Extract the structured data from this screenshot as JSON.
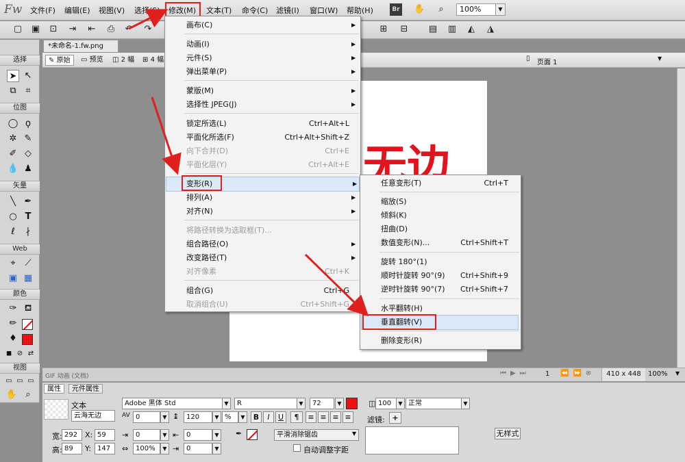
{
  "app": {
    "logo": "Fw",
    "menus": [
      "文件(F)",
      "编辑(E)",
      "视图(V)",
      "选择(S)",
      "修改(M)",
      "文本(T)",
      "命令(C)",
      "滤镜(I)",
      "窗口(W)",
      "帮助(H)"
    ],
    "bridge_badge": "Br",
    "zoom": "100%"
  },
  "document": {
    "tab_title": "*未命名-1.fw.png",
    "views": [
      "原始",
      "预览",
      "2 幅",
      "4 幅"
    ],
    "page_label": "页面 1",
    "canvas_text": "无边"
  },
  "tools": {
    "sections": [
      "选择",
      "位图",
      "矢量",
      "Web",
      "颜色",
      "视图"
    ]
  },
  "status": {
    "left": "GIF 动画 (文档)",
    "frame": "1",
    "size": "410 x 448",
    "zoom": "100%"
  },
  "properties": {
    "tabs": [
      "属性",
      "元件属性"
    ],
    "type_label": "文本",
    "object_name": "云海无边",
    "font": "Adobe 黑体 Std",
    "style": "R",
    "size": "72",
    "kerning": "0",
    "leading": "120",
    "leading_unit": "%",
    "bold": "B",
    "italic": "I",
    "underline": "U",
    "width_label": "宽:",
    "width": "292",
    "x_label": "X:",
    "x": "59",
    "height_label": "高:",
    "height": "89",
    "y_label": "Y:",
    "y": "147",
    "indent1": "0",
    "indent2": "0",
    "indent3": "0",
    "indent4": "0",
    "scale": "100%",
    "opacity": "100",
    "blend": "正常",
    "filters_label": "滤镜:",
    "antialias": "平滑消除锯齿",
    "auto_kern": "自动调整字距",
    "no_style": "无样式"
  },
  "modify_menu": {
    "items": [
      {
        "label": "画布(C)",
        "shortcut": "",
        "submenu": true,
        "disabled": false
      },
      {
        "label": "动画(I)",
        "shortcut": "",
        "submenu": true,
        "disabled": false
      },
      {
        "label": "元件(S)",
        "shortcut": "",
        "submenu": true,
        "disabled": false
      },
      {
        "label": "弹出菜单(P)",
        "shortcut": "",
        "submenu": true,
        "disabled": false
      },
      {
        "label": "蒙版(M)",
        "shortcut": "",
        "submenu": true,
        "disabled": false
      },
      {
        "label": "选择性 JPEG(J)",
        "shortcut": "",
        "submenu": true,
        "disabled": false
      },
      {
        "label": "锁定所选(L)",
        "shortcut": "Ctrl+Alt+L",
        "submenu": false,
        "disabled": false
      },
      {
        "label": "平面化所选(F)",
        "shortcut": "Ctrl+Alt+Shift+Z",
        "submenu": false,
        "disabled": false
      },
      {
        "label": "向下合并(D)",
        "shortcut": "Ctrl+E",
        "submenu": false,
        "disabled": true
      },
      {
        "label": "平面化层(Y)",
        "shortcut": "Ctrl+Alt+E",
        "submenu": false,
        "disabled": true
      },
      {
        "label": "变形(R)",
        "shortcut": "",
        "submenu": true,
        "disabled": false
      },
      {
        "label": "排列(A)",
        "shortcut": "",
        "submenu": true,
        "disabled": false
      },
      {
        "label": "对齐(N)",
        "shortcut": "",
        "submenu": true,
        "disabled": false
      },
      {
        "label": "将路径转换为选取框(T)...",
        "shortcut": "",
        "submenu": false,
        "disabled": true
      },
      {
        "label": "组合路径(O)",
        "shortcut": "",
        "submenu": true,
        "disabled": false
      },
      {
        "label": "改变路径(T)",
        "shortcut": "",
        "submenu": true,
        "disabled": false
      },
      {
        "label": "对齐像素",
        "shortcut": "Ctrl+K",
        "submenu": false,
        "disabled": true
      },
      {
        "label": "组合(G)",
        "shortcut": "Ctrl+G",
        "submenu": false,
        "disabled": false
      },
      {
        "label": "取消组合(U)",
        "shortcut": "Ctrl+Shift+G",
        "submenu": false,
        "disabled": true
      }
    ]
  },
  "transform_menu": {
    "items": [
      {
        "label": "任意变形(T)",
        "shortcut": "Ctrl+T"
      },
      {
        "label": "缩放(S)",
        "shortcut": ""
      },
      {
        "label": "倾斜(K)",
        "shortcut": ""
      },
      {
        "label": "扭曲(D)",
        "shortcut": ""
      },
      {
        "label": "数值变形(N)...",
        "shortcut": "Ctrl+Shift+T"
      },
      {
        "label": "旋转 180°(1)",
        "shortcut": ""
      },
      {
        "label": "顺时针旋转 90°(9)",
        "shortcut": "Ctrl+Shift+9"
      },
      {
        "label": "逆时针旋转 90°(7)",
        "shortcut": "Ctrl+Shift+7"
      },
      {
        "label": "水平翻转(H)",
        "shortcut": ""
      },
      {
        "label": "垂直翻转(V)",
        "shortcut": ""
      },
      {
        "label": "删除变形(R)",
        "shortcut": ""
      }
    ]
  },
  "colors": {
    "highlight_red": "#e0201c",
    "canvas_text": "#e0141c"
  }
}
